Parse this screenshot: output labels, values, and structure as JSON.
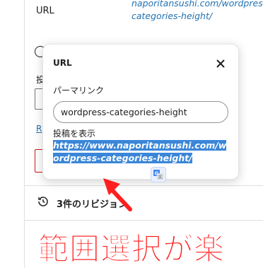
{
  "background": {
    "url_label": "URL",
    "url_value": "naporitansushi.com/wordpress-categories-height/",
    "r_link": "R",
    "revisions_label": "3件のリビジョン"
  },
  "popover": {
    "title": "URL",
    "permalink_label": "パーマリンク",
    "slug_value": "wordpress-categories-height",
    "view_post_label": "投稿を表示",
    "post_url": "https://www.naporitansushi.com/wordpress-categories-height/"
  },
  "annotation": {
    "caption": "範囲選択が楽"
  },
  "colors": {
    "link": "#2271b1",
    "selection": "#3a86d8",
    "caption": "#ff1f1f",
    "danger": "#cc1818"
  },
  "icons": {
    "close": "close-icon",
    "history": "history-icon",
    "translate": "google-translate-icon",
    "arrow": "red-arrow-icon"
  }
}
